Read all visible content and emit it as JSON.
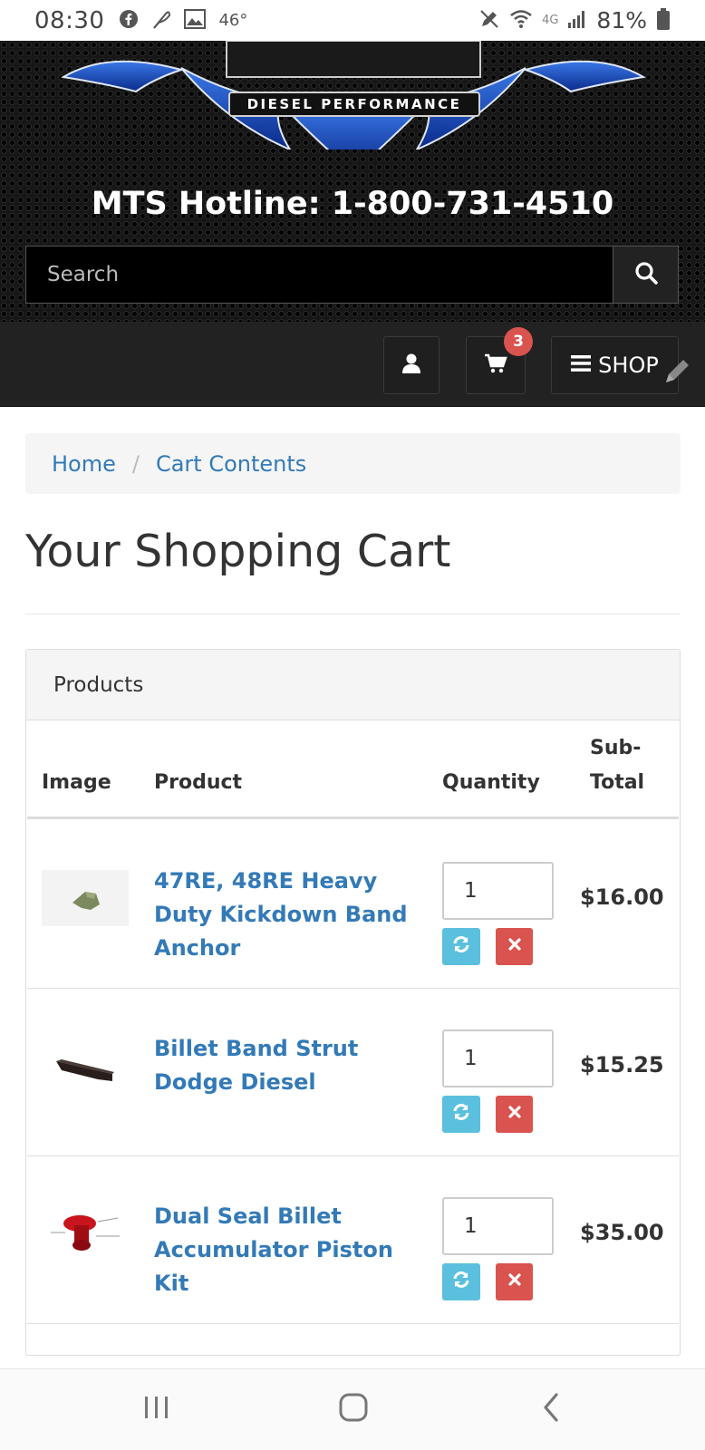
{
  "status_bar": {
    "time": "08:30",
    "temperature": "46°",
    "network": "4G",
    "battery": "81%"
  },
  "header": {
    "logo_text": "DIESEL PERFORMANCE",
    "hotline": "MTS Hotline: 1-800-731-4510",
    "search_placeholder": "Search"
  },
  "nav": {
    "cart_count": "3",
    "shop_label": "SHOP"
  },
  "breadcrumb": {
    "home": "Home",
    "separator": "/",
    "current": "Cart Contents"
  },
  "page_title": "Your Shopping Cart",
  "cart": {
    "panel_heading": "Products",
    "columns": {
      "image": "Image",
      "product": "Product",
      "quantity": "Quantity",
      "subtotal_line1": "Sub-",
      "subtotal_line2": "Total"
    },
    "items": [
      {
        "name": "47RE, 48RE Heavy Duty Kickdown Band Anchor",
        "quantity": "1",
        "subtotal": "$16.00"
      },
      {
        "name": "Billet Band Strut Dodge Diesel",
        "quantity": "1",
        "subtotal": "$15.25"
      },
      {
        "name": "Dual Seal Billet Accumulator Piston Kit",
        "quantity": "1",
        "subtotal": "$35.00"
      }
    ]
  },
  "colors": {
    "link": "#337ab7",
    "badge": "#d9534f",
    "refresh_button": "#5bc0de",
    "remove_button": "#d9534f",
    "header_background": "#161616"
  }
}
